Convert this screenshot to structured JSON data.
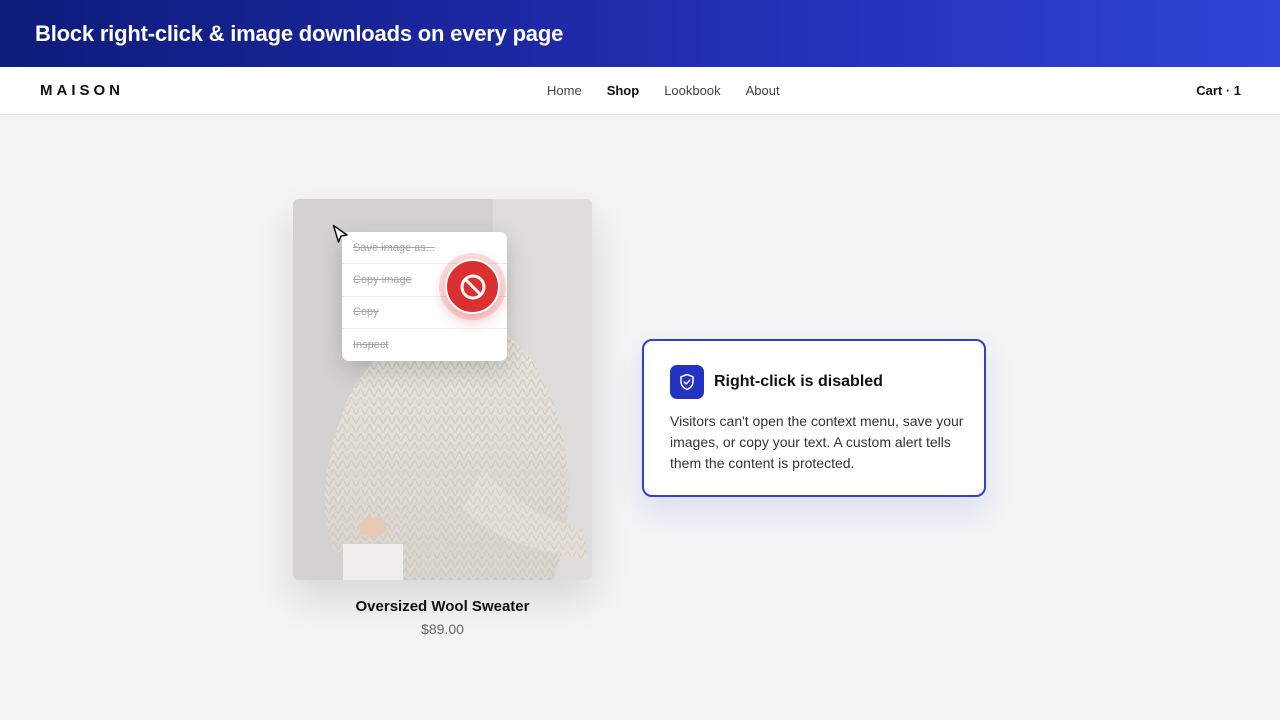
{
  "banner": {
    "title": "Block right-click & image downloads on every page"
  },
  "navbar": {
    "logo": "MAISON",
    "links": [
      {
        "label": "Home"
      },
      {
        "label": "Shop",
        "active": true
      },
      {
        "label": "Lookbook"
      },
      {
        "label": "About"
      }
    ],
    "cart": "Cart · 1"
  },
  "product": {
    "name": "Oversized Wool Sweater",
    "price": "$89.00"
  },
  "context_menu": {
    "items": [
      "Save image as...",
      "Copy image",
      "Copy",
      "Inspect"
    ],
    "state": "disabled"
  },
  "info_card": {
    "title": "Right-click is disabled",
    "body": "Visitors can't open the context menu, save your images, or copy your text. A custom alert tells them the content is protected."
  },
  "colors": {
    "banner_start": "#0d1b7a",
    "banner_end": "#2e44d6",
    "accent": "#2433c4",
    "block_red": "#dc2f2f",
    "page_bg": "#f4f4f5"
  },
  "icons": [
    "cursor-arrow-icon",
    "block-icon",
    "shield-check-icon"
  ]
}
